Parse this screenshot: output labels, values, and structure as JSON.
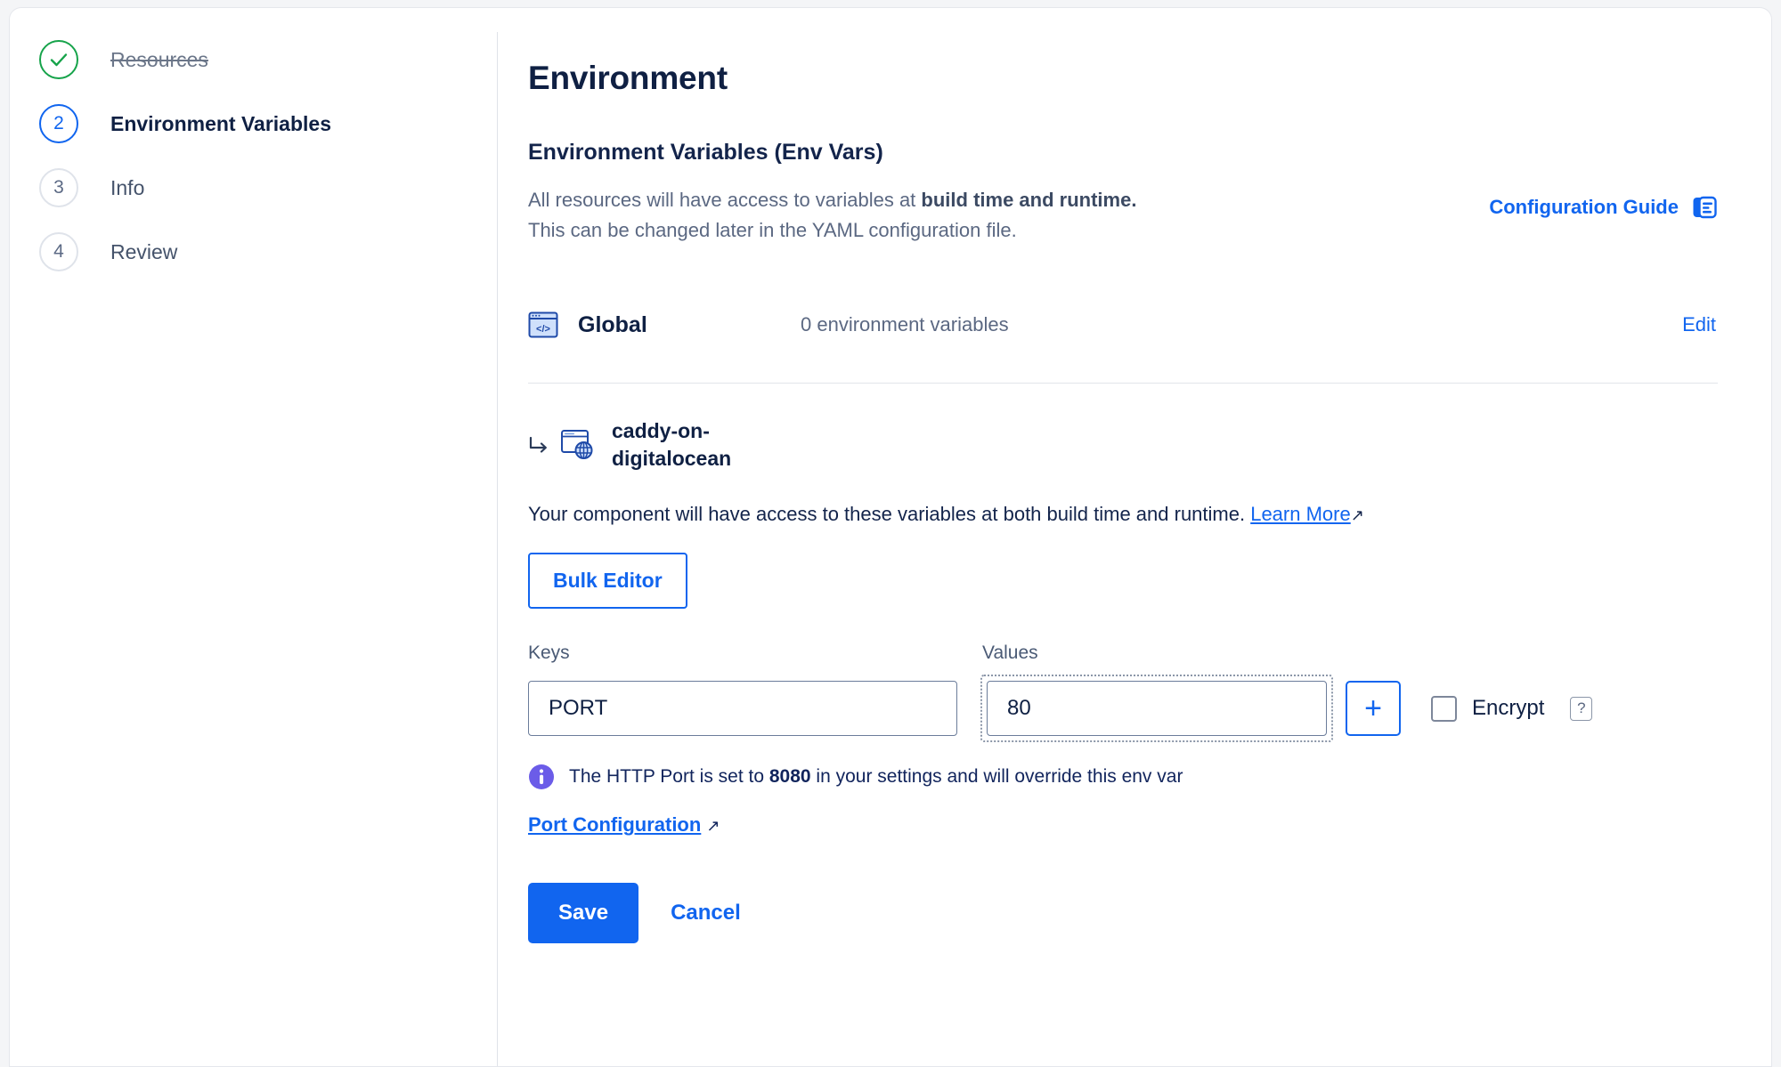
{
  "wizard": {
    "steps": [
      {
        "badge": "check-icon",
        "label": "Resources",
        "state": "done"
      },
      {
        "badge": "2",
        "label": "Environment Variables",
        "state": "active"
      },
      {
        "badge": "3",
        "label": "Info",
        "state": "todo"
      },
      {
        "badge": "4",
        "label": "Review",
        "state": "todo"
      }
    ]
  },
  "main": {
    "page_title": "Environment",
    "section_title": "Environment Variables (Env Vars)",
    "description_line1_pre": "All resources will have access to variables at ",
    "description_line1_bold": "build time and runtime.",
    "description_line2": "This can be changed later in the YAML configuration file.",
    "configuration_guide": {
      "label": "Configuration Guide",
      "icon": "document-guide-icon"
    },
    "global": {
      "icon": "code-window-icon",
      "name": "Global",
      "count_text": "0 environment variables",
      "edit_label": "Edit"
    },
    "component": {
      "arrow_icon": "subdirectory-arrow-icon",
      "icon": "globe-window-icon",
      "name": "caddy-on-digitalocean",
      "description_pre": "Your component will have access to these variables at both build time and runtime. ",
      "learn_more_label": "Learn More",
      "external_arrow": "↗"
    },
    "bulk_editor_label": "Bulk Editor",
    "form": {
      "keys_label": "Keys",
      "values_label": "Values",
      "key_value": "PORT",
      "key_placeholder": "",
      "value_value": "80",
      "value_placeholder": "",
      "add_button_label": "+",
      "encrypt_label": "Encrypt",
      "encrypt_checked": false,
      "help_label": "?"
    },
    "info": {
      "icon": "info-circle-icon",
      "text_pre": "The HTTP Port is set to ",
      "text_bold": "8080",
      "text_post": " in your settings and will override this env var"
    },
    "port_configuration": {
      "label": "Port Configuration",
      "external_arrow": "↗"
    },
    "save_label": "Save",
    "cancel_label": "Cancel"
  },
  "colors": {
    "accent_blue": "#1165ef",
    "success_green": "#16a34a",
    "info_purple": "#6b5ce8",
    "text_dark": "#0f2043",
    "text_muted": "#5b6882"
  }
}
